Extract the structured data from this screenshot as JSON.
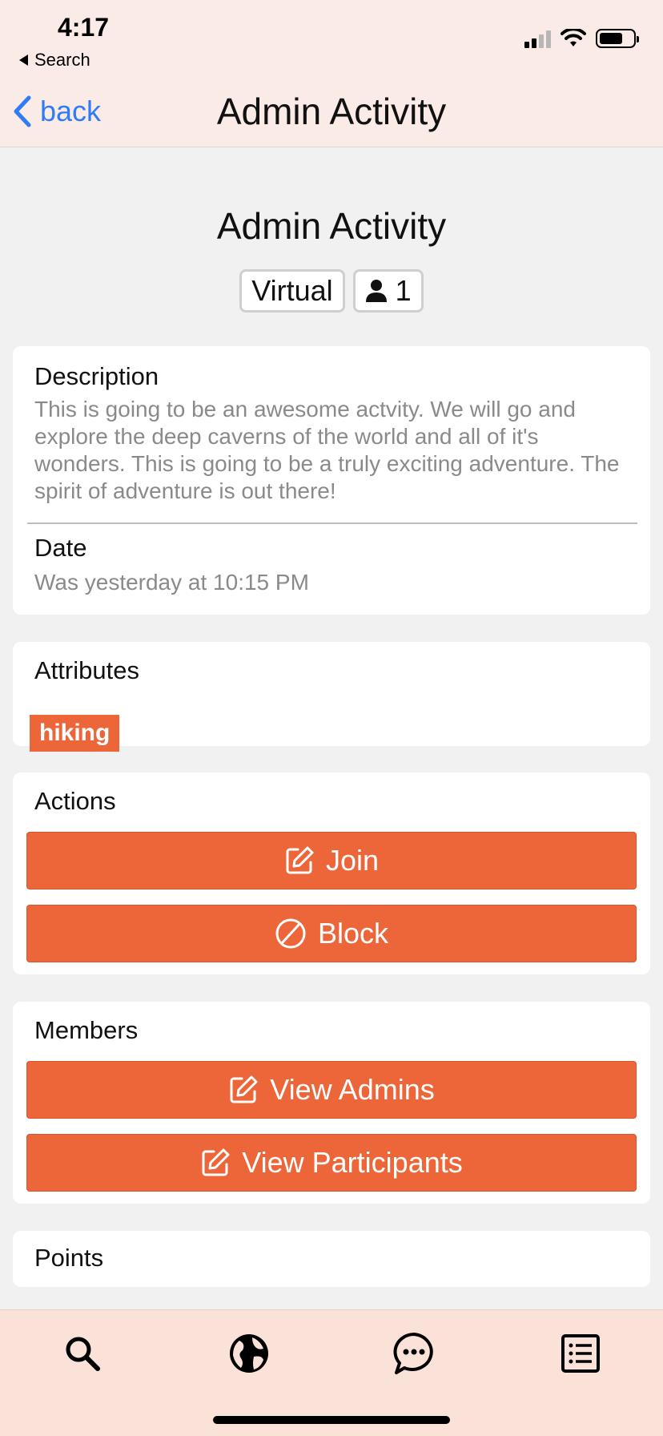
{
  "status_bar": {
    "time": "4:17",
    "back_app": "Search"
  },
  "nav": {
    "back_label": "back",
    "title": "Admin Activity"
  },
  "header": {
    "title": "Admin Activity",
    "chip_type": "Virtual",
    "chip_count": "1"
  },
  "details": {
    "description_label": "Description",
    "description_text": "This is going to be an awesome actvity. We will go and explore the deep caverns of the world and all of it's wonders. This is going to be a truly exciting adventure. The spirit of adventure is out there!",
    "date_label": "Date",
    "date_text": "Was yesterday at 10:15 PM"
  },
  "attributes": {
    "label": "Attributes",
    "tags": [
      "hiking"
    ]
  },
  "actions": {
    "label": "Actions",
    "join": "Join",
    "block": "Block"
  },
  "members": {
    "label": "Members",
    "view_admins": "View Admins",
    "view_participants": "View Participants"
  },
  "points": {
    "label": "Points"
  },
  "colors": {
    "accent": "#ed6639",
    "link": "#2f7cf6",
    "topbar": "#fbebe6",
    "tabbar": "#fbe2d9"
  },
  "tabs": [
    "search-icon",
    "globe-icon",
    "chat-icon",
    "list-icon"
  ]
}
